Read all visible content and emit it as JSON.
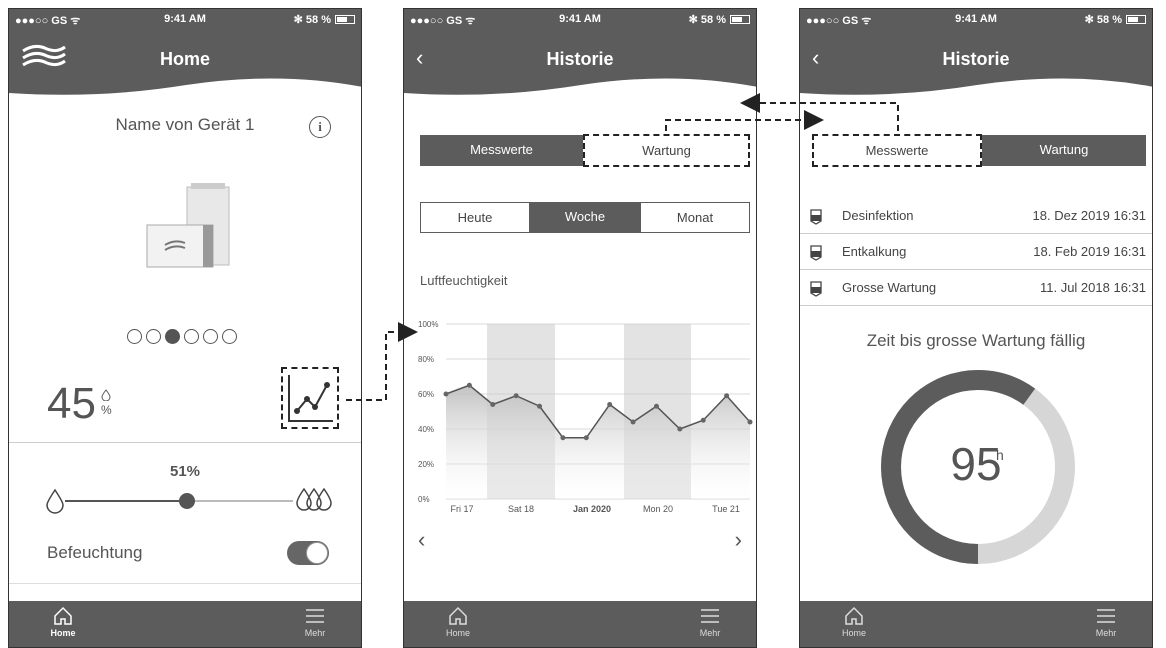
{
  "status": {
    "carrier": "●●●○○ GS ᯤ",
    "time": "9:41 AM",
    "battery": "✻ 58 %"
  },
  "screen1": {
    "title": "Home",
    "device_name": "Name von Gerät 1",
    "info": "i",
    "page_count": 6,
    "active_page": 3,
    "humidity": "45",
    "humidity_unit": "%",
    "target": "51%",
    "target_fraction": 0.51,
    "humidify_label": "Befeuchtung",
    "humidify_on": true,
    "tabs": {
      "home": "Home",
      "more": "Mehr"
    }
  },
  "screen2": {
    "title": "Historie",
    "seg_left": "Messwerte",
    "seg_right": "Wartung",
    "range": [
      "Heute",
      "Woche",
      "Monat"
    ],
    "range_active": "Woche",
    "chart_title": "Luftfeuchtigkeit",
    "tabs": {
      "home": "Home",
      "more": "Mehr"
    }
  },
  "screen3": {
    "title": "Historie",
    "seg_left": "Messwerte",
    "seg_right": "Wartung",
    "events": [
      {
        "name": "Desinfektion",
        "date": "18. Dez 2019 16:31"
      },
      {
        "name": "Entkalkung",
        "date": "18. Feb 2019 16:31"
      },
      {
        "name": "Grosse Wartung",
        "date": "11. Jul 2018 16:31"
      }
    ],
    "due_title": "Zeit bis grosse Wartung fällig",
    "due_value": "95",
    "due_unit": "h",
    "due_fraction": 0.6,
    "tabs": {
      "home": "Home",
      "more": "Mehr"
    }
  },
  "chart_data": {
    "type": "line",
    "title": "Luftfeuchtigkeit",
    "y_ticks": [
      "0%",
      "20%",
      "40%",
      "60%",
      "80%",
      "100%"
    ],
    "ylim": [
      0,
      100
    ],
    "x_ticks": [
      "Fri 17",
      "Sat 18",
      "Jan 2020",
      "Mon 20",
      "Tue 21"
    ],
    "series": [
      {
        "values": [
          60,
          65,
          54,
          59,
          53,
          35,
          35,
          54,
          44,
          53,
          40,
          45,
          59,
          44
        ]
      }
    ],
    "grid": true
  }
}
